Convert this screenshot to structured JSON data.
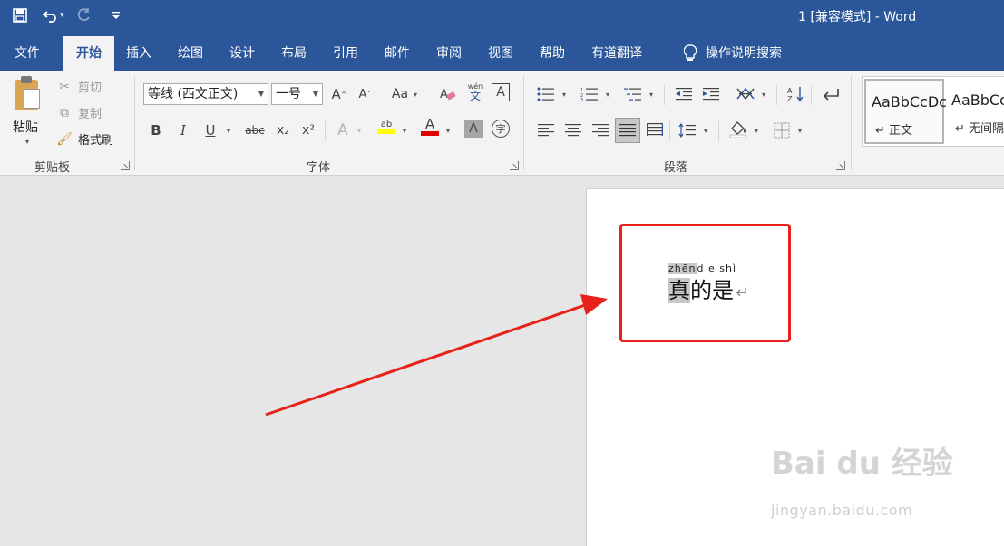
{
  "titlebar": {
    "title": "1 [兼容模式]  -  Word",
    "qat_caret": "▾"
  },
  "tabs": [
    "文件",
    "开始",
    "插入",
    "绘图",
    "设计",
    "布局",
    "引用",
    "邮件",
    "审阅",
    "视图",
    "帮助",
    "有道翻译",
    "操作说明搜索"
  ],
  "ribbon": {
    "clipboard": {
      "label": "剪贴板",
      "paste": "粘贴",
      "cut": "剪切",
      "copy": "复制",
      "format_painter": "格式刷"
    },
    "font": {
      "label": "字体",
      "font_name": "等线 (西文正文)",
      "font_size": "一号",
      "bold": "B",
      "italic": "I",
      "underline": "U",
      "strike": "abc",
      "subscript": "x₂",
      "superscript": "x²",
      "grow": "A",
      "shrink": "A",
      "change_case": "Aa",
      "phonetic_top": "wén",
      "phonetic_bottom": "文",
      "charborder": "A",
      "text_effects": "A",
      "highlight": "ab",
      "font_color": "A",
      "char_shading": "A",
      "enclose": "字"
    },
    "paragraph": {
      "label": "段落"
    },
    "styles": {
      "normal_sample": "AaBbCcDc",
      "normal_name": "↵ 正文",
      "nospace_sample": "AaBbCc",
      "nospace_name": "↵ 无间隔"
    }
  },
  "document": {
    "ruby_highlight": "zhēn",
    "ruby_rest": "d e shì",
    "text_highlight": "真",
    "text_rest": "的是",
    "para_mark": "↵"
  },
  "watermark": {
    "main": "Bai du 经验",
    "sub": "jingyan.baidu.com"
  },
  "colors": {
    "title_blue": "#2b579a",
    "ribbon_bg": "#f3f3f3",
    "annotation_red": "#e8221a",
    "highlight_yellow": "#ffff00",
    "font_red": "#e00000"
  }
}
